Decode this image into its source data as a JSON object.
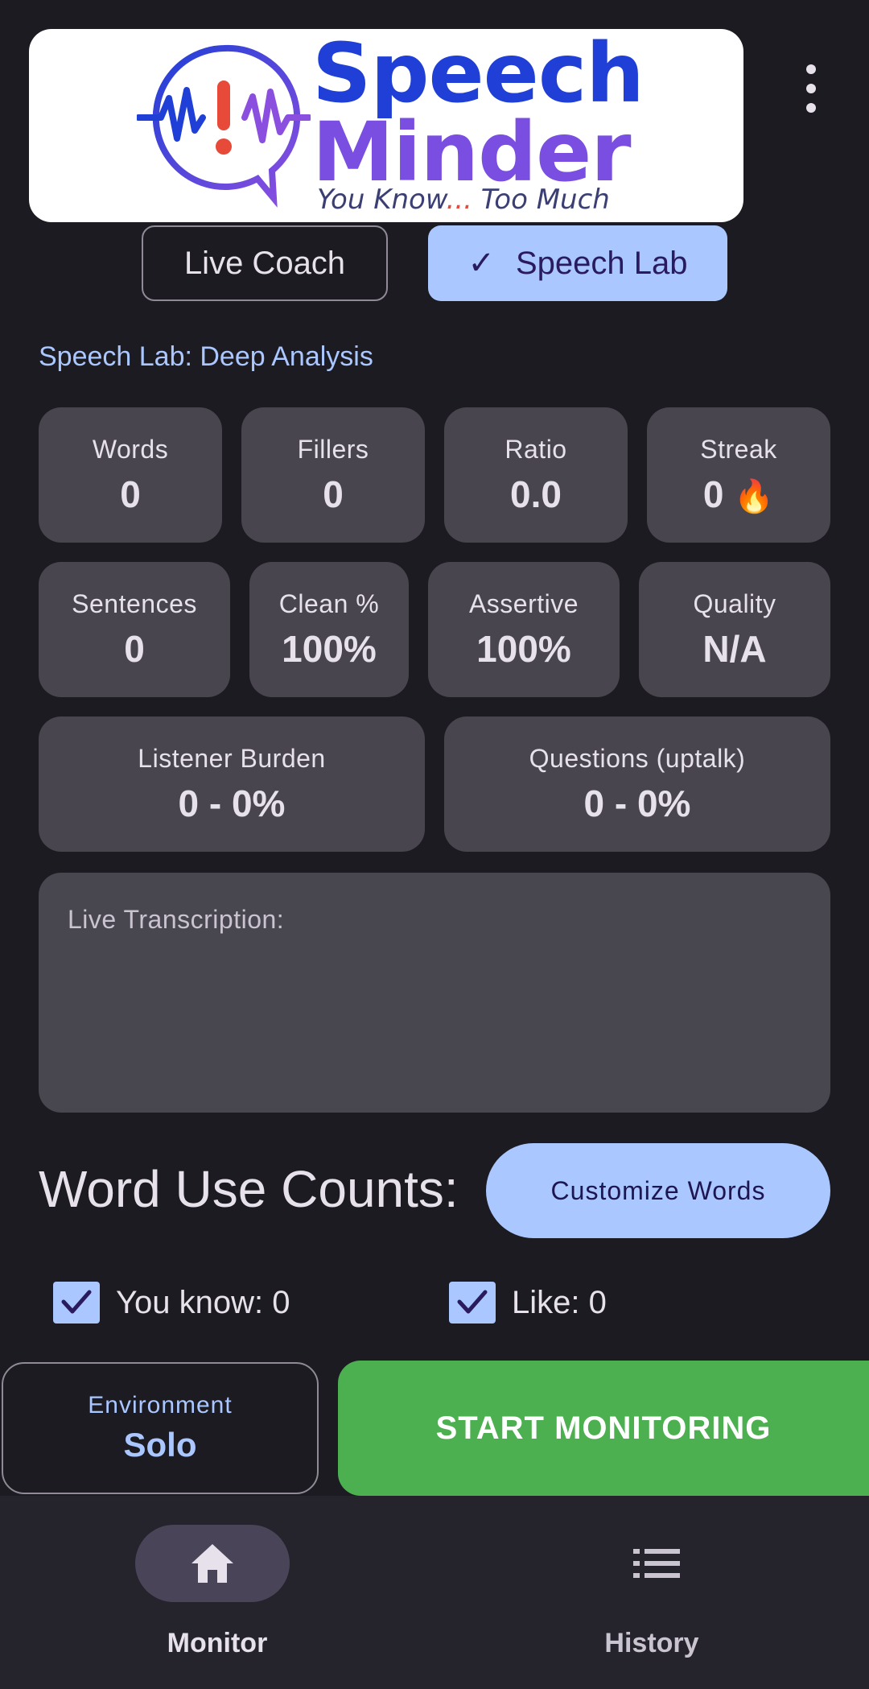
{
  "header": {
    "logo_word1": "Speech",
    "logo_word2": "Minder",
    "logo_tagline_a": "You Know",
    "logo_tagline_dots": "...",
    "logo_tagline_b": " Too Much"
  },
  "segments": [
    {
      "label": "Live Coach",
      "selected": false
    },
    {
      "label": "Speech Lab",
      "selected": true
    }
  ],
  "section_title": "Speech Lab: Deep Analysis",
  "stats_row1": [
    {
      "label": "Words",
      "value": "0"
    },
    {
      "label": "Fillers",
      "value": "0"
    },
    {
      "label": "Ratio",
      "value": "0.0"
    },
    {
      "label": "Streak",
      "value": "0"
    }
  ],
  "stats_row2": [
    {
      "label": "Sentences",
      "value": "0"
    },
    {
      "label": "Clean %",
      "value": "100%"
    },
    {
      "label": "Assertive",
      "value": "100%"
    },
    {
      "label": "Quality",
      "value": "N/A"
    }
  ],
  "stats_row3": [
    {
      "label": "Listener Burden",
      "value": "0 - 0%"
    },
    {
      "label": "Questions (uptalk)",
      "value": "0 - 0%"
    }
  ],
  "transcription": {
    "label": "Live Transcription:"
  },
  "word_use": {
    "title": "Word Use Counts:",
    "customize_label": "Customize Words",
    "items": [
      {
        "label": "You know: 0",
        "checked": true
      },
      {
        "label": "Like: 0",
        "checked": true
      }
    ]
  },
  "environment": {
    "label": "Environment",
    "value": "Solo"
  },
  "start_label": "START MONITORING",
  "nav": [
    {
      "label": "Monitor",
      "icon": "home-icon",
      "active": true
    },
    {
      "label": "History",
      "icon": "list-icon",
      "active": false
    }
  ],
  "colors": {
    "background": "#1c1b21",
    "accent": "#aac7ff",
    "card": "#49454f",
    "start": "#4caf50",
    "nav": "#25232c"
  }
}
